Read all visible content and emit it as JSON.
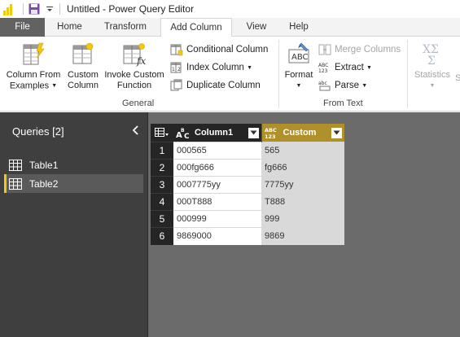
{
  "window": {
    "title": "Untitled - Power Query Editor"
  },
  "tabs": {
    "file": "File",
    "home": "Home",
    "transform": "Transform",
    "add_column": "Add Column",
    "view": "View",
    "help": "Help",
    "active": "Add Column"
  },
  "ribbon": {
    "general": {
      "label": "General",
      "column_from_examples": [
        "Column From",
        "Examples"
      ],
      "custom_column": [
        "Custom",
        "Column"
      ],
      "invoke_custom_function": [
        "Invoke Custom",
        "Function"
      ],
      "conditional_column": "Conditional Column",
      "index_column": "Index Column",
      "duplicate_column": "Duplicate Column"
    },
    "from_text": {
      "label": "From Text",
      "format": "Format",
      "merge_columns": "Merge Columns",
      "extract": "Extract",
      "parse": "Parse"
    },
    "from_number": {
      "statistics": "Statistics",
      "truncated": "S"
    }
  },
  "queries": {
    "header": "Queries [2]",
    "items": [
      {
        "label": "Table1",
        "selected": false
      },
      {
        "label": "Table2",
        "selected": true
      }
    ]
  },
  "grid": {
    "columns": [
      {
        "name": "Column1",
        "type_icon": "text-type-icon"
      },
      {
        "name": "Custom",
        "type_icon": "any-type-icon"
      }
    ],
    "rows": [
      {
        "n": "1",
        "c1": "000565",
        "c2": "565"
      },
      {
        "n": "2",
        "c1": "000fg666",
        "c2": "fg666"
      },
      {
        "n": "3",
        "c1": "0007775yy",
        "c2": "7775yy"
      },
      {
        "n": "4",
        "c1": "000T888",
        "c2": "T888"
      },
      {
        "n": "5",
        "c1": "000999",
        "c2": "999"
      },
      {
        "n": "6",
        "c1": "9869000",
        "c2": "9869"
      }
    ]
  },
  "colors": {
    "accent": "#f2c811",
    "selected_column": "#b0902b",
    "file_tab": "#626262",
    "queries_bg": "#3f3f3f",
    "grid_bg": "#6b6b6b"
  }
}
